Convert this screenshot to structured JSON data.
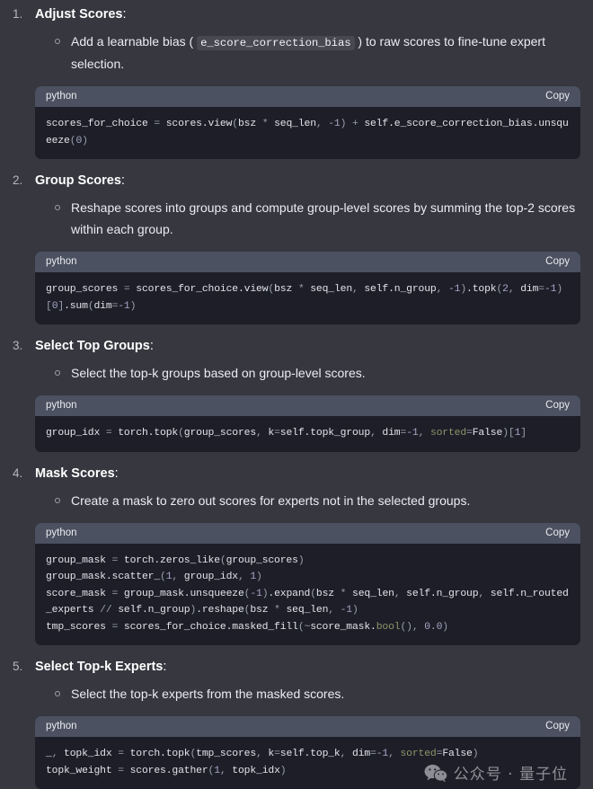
{
  "code_header": {
    "language": "python",
    "copy_label": "Copy"
  },
  "watermark": {
    "text": "公众号 · 量子位",
    "icon": "wechat-icon"
  },
  "steps": [
    {
      "number": "1.",
      "title": "Adjust Scores",
      "colon": ":",
      "bullets": [
        {
          "pre": "Add a learnable bias (",
          "code": "e_score_correction_bias",
          "post": ") to raw scores to fine-tune expert selection."
        }
      ],
      "code": "scores_for_choice = scores.view(bsz * seq_len, -1) + self.e_score_correction_bias.unsqueeze(0)"
    },
    {
      "number": "2.",
      "title": "Group Scores",
      "colon": ":",
      "bullets": [
        {
          "pre": "Reshape scores into groups and compute group-level scores by summing the top-2 scores within each group.",
          "code": "",
          "post": ""
        }
      ],
      "code": "group_scores = scores_for_choice.view(bsz * seq_len, self.n_group, -1).topk(2, dim=-1)[0].sum(dim=-1)"
    },
    {
      "number": "3.",
      "title": "Select Top Groups",
      "colon": ":",
      "bullets": [
        {
          "pre": "Select the top-k groups based on group-level scores.",
          "code": "",
          "post": ""
        }
      ],
      "code": "group_idx = torch.topk(group_scores, k=self.topk_group, dim=-1, sorted=False)[1]"
    },
    {
      "number": "4.",
      "title": "Mask Scores",
      "colon": ":",
      "bullets": [
        {
          "pre": "Create a mask to zero out scores for experts not in the selected groups.",
          "code": "",
          "post": ""
        }
      ],
      "code": "group_mask = torch.zeros_like(group_scores)\ngroup_mask.scatter_(1, group_idx, 1)\nscore_mask = group_mask.unsqueeze(-1).expand(bsz * seq_len, self.n_group, self.n_routed_experts // self.n_group).reshape(bsz * seq_len, -1)\ntmp_scores = scores_for_choice.masked_fill(~score_mask.bool(), 0.0)"
    },
    {
      "number": "5.",
      "title": "Select Top-k Experts",
      "colon": ":",
      "bullets": [
        {
          "pre": "Select the top-k experts from the masked scores.",
          "code": "",
          "post": ""
        }
      ],
      "code": "_, topk_idx = torch.topk(tmp_scores, k=self.top_k, dim=-1, sorted=False)\ntopk_weight = scores.gather(1, topk_idx)"
    }
  ],
  "colors": {
    "page_bg": "#36373f",
    "code_bg": "#1d1e28",
    "code_header_bg": "#4b5160",
    "text": "#ececf1",
    "marker": "#b4b7c0",
    "keyword": "#8f9468",
    "number": "#a9a4c4"
  }
}
